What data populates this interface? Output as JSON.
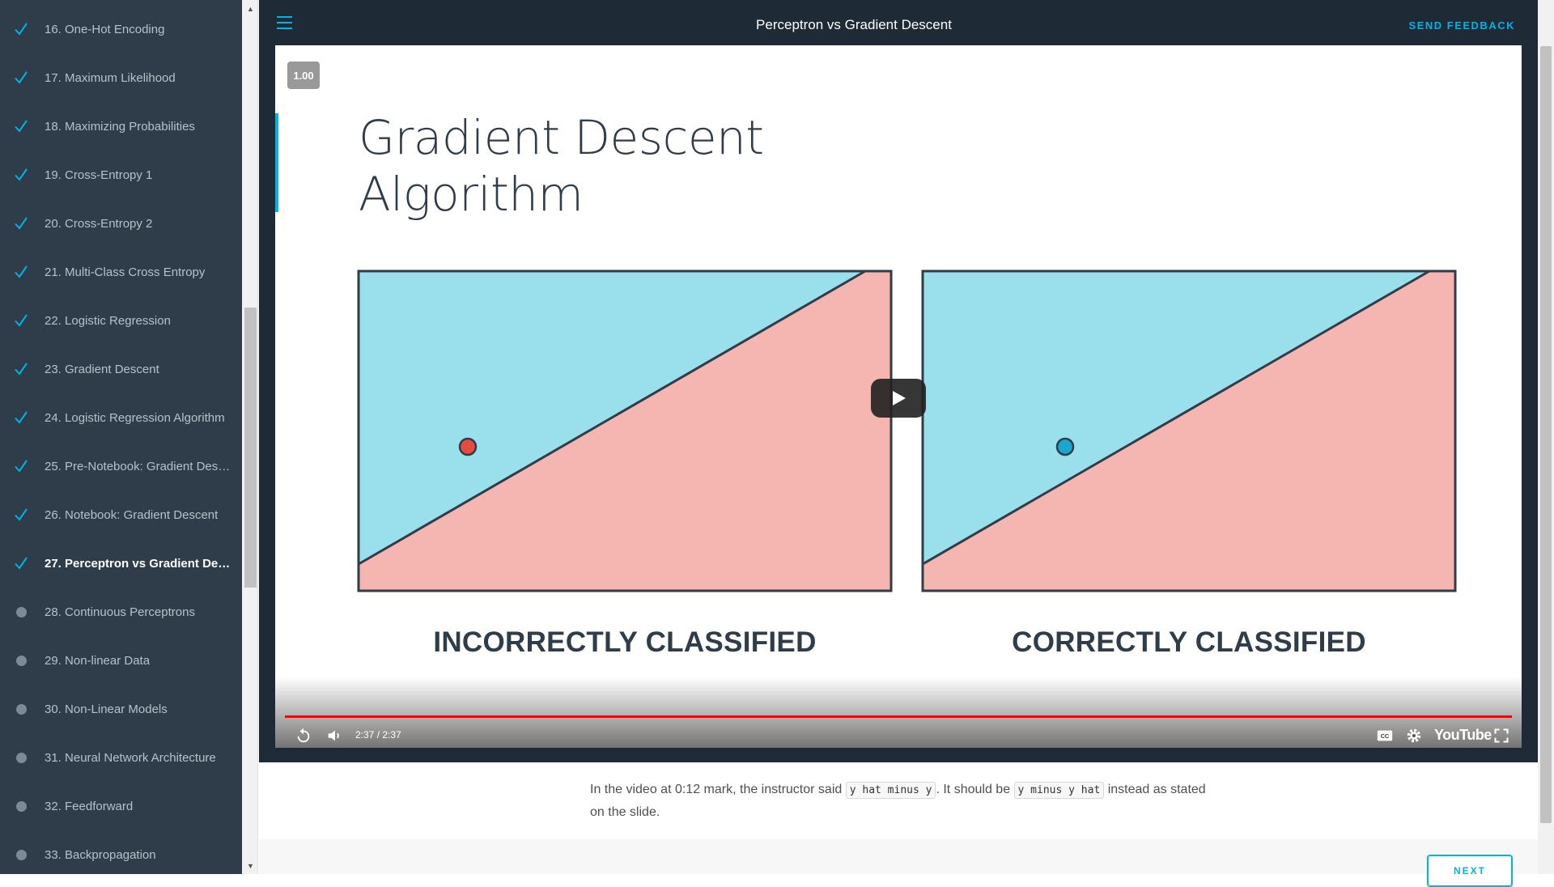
{
  "header": {
    "title": "Perceptron vs Gradient Descent",
    "feedback_label": "SEND FEEDBACK"
  },
  "sidebar": {
    "items": [
      {
        "label": "16. One-Hot Encoding",
        "status": "complete"
      },
      {
        "label": "17. Maximum Likelihood",
        "status": "complete"
      },
      {
        "label": "18. Maximizing Probabilities",
        "status": "complete"
      },
      {
        "label": "19. Cross-Entropy 1",
        "status": "complete"
      },
      {
        "label": "20. Cross-Entropy 2",
        "status": "complete"
      },
      {
        "label": "21. Multi-Class Cross Entropy",
        "status": "complete"
      },
      {
        "label": "22. Logistic Regression",
        "status": "complete"
      },
      {
        "label": "23. Gradient Descent",
        "status": "complete"
      },
      {
        "label": "24. Logistic Regression Algorithm",
        "status": "complete"
      },
      {
        "label": "25. Pre-Notebook: Gradient Desc...",
        "status": "complete"
      },
      {
        "label": "26. Notebook: Gradient Descent",
        "status": "complete"
      },
      {
        "label": "27. Perceptron vs Gradient Desc...",
        "status": "complete",
        "active": true
      },
      {
        "label": "28. Continuous Perceptrons",
        "status": "incomplete"
      },
      {
        "label": "29. Non-linear Data",
        "status": "incomplete"
      },
      {
        "label": "30. Non-Linear Models",
        "status": "incomplete"
      },
      {
        "label": "31. Neural Network Architecture",
        "status": "incomplete"
      },
      {
        "label": "32. Feedforward",
        "status": "incomplete"
      },
      {
        "label": "33. Backpropagation",
        "status": "incomplete"
      }
    ]
  },
  "video": {
    "speed": "1.00",
    "slide_title_line1": "Gradient Descent",
    "slide_title_line2": "Algorithm",
    "caption_left": "INCORRECTLY CLASSIFIED",
    "caption_right": "CORRECTLY CLASSIFIED",
    "time": "2:37 / 2:37",
    "progress": 1.0,
    "youtube_label": "YouTube"
  },
  "note": {
    "part1": "In the video at 0:12 mark, the instructor said ",
    "code1": "y hat minus y",
    "part2": ". It should be ",
    "code2": "y minus y hat",
    "part3": " instead as stated on the slide."
  },
  "next_label": "NEXT",
  "colors": {
    "accent": "#02b3e4",
    "sidebar_bg": "#2e3d49",
    "header_bg": "#1e2a35",
    "blue_region": "#99dfec",
    "red_region": "#f5b5b0",
    "red_point": "#e84a3f",
    "blue_point": "#1aa6cf"
  }
}
